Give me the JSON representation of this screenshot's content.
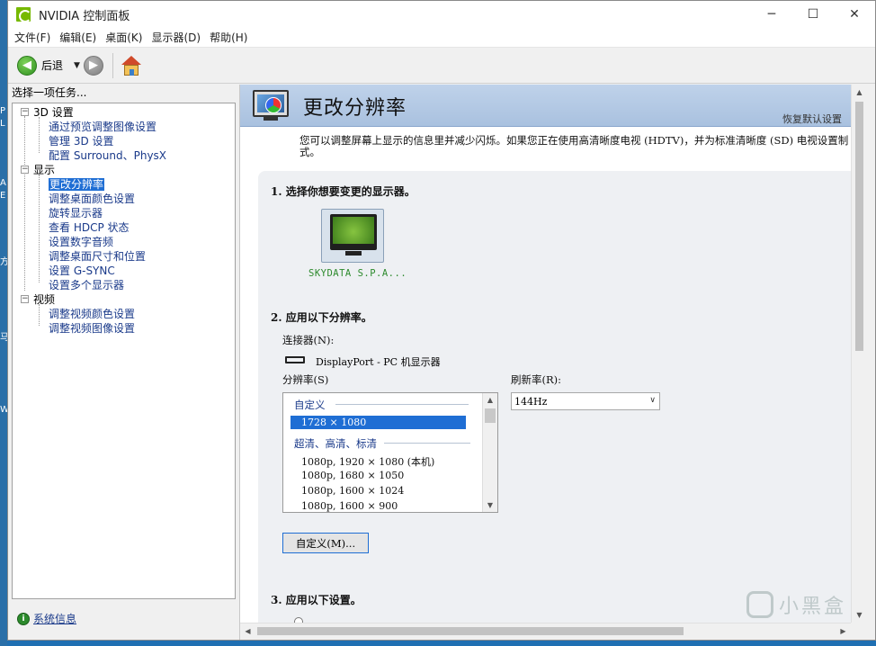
{
  "window": {
    "title": "NVIDIA 控制面板",
    "controls": {
      "minimize": "─",
      "maximize": "☐",
      "close": "✕"
    }
  },
  "menu": [
    "文件(F)",
    "编辑(E)",
    "桌面(K)",
    "显示器(D)",
    "帮助(H)"
  ],
  "toolbar": {
    "back_label": "后退"
  },
  "left_pane": {
    "header": "选择一项任务...",
    "tree": [
      {
        "label": "3D 设置",
        "kind": "category"
      },
      {
        "label": "通过预览调整图像设置",
        "kind": "link"
      },
      {
        "label": "管理 3D 设置",
        "kind": "link"
      },
      {
        "label": "配置 Surround、PhysX",
        "kind": "link"
      },
      {
        "label": "显示",
        "kind": "category"
      },
      {
        "label": "更改分辨率",
        "kind": "selected"
      },
      {
        "label": "调整桌面颜色设置",
        "kind": "link"
      },
      {
        "label": "旋转显示器",
        "kind": "link"
      },
      {
        "label": "查看 HDCP 状态",
        "kind": "link"
      },
      {
        "label": "设置数字音频",
        "kind": "link"
      },
      {
        "label": "调整桌面尺寸和位置",
        "kind": "link"
      },
      {
        "label": "设置 G-SYNC",
        "kind": "link"
      },
      {
        "label": "设置多个显示器",
        "kind": "link"
      },
      {
        "label": "视频",
        "kind": "category"
      },
      {
        "label": "调整视频颜色设置",
        "kind": "link"
      },
      {
        "label": "调整视频图像设置",
        "kind": "link"
      }
    ],
    "system_info": "系统信息"
  },
  "content": {
    "title": "更改分辨率",
    "restore_defaults": "恢复默认设置",
    "description": "您可以调整屏幕上显示的信息里并减少闪烁。如果您正在使用高清晰度电视 (HDTV)，并为标准清晰度 (SD) 电视设置制式。",
    "step1": "1. 选择你想要变更的显示器。",
    "display_name": "SKYDATA S.P.A...",
    "step2": "2. 应用以下分辨率。",
    "connector_label": "连接器(N):",
    "connector_value": "DisplayPort - PC 机显示器",
    "resolution_label": "分辨率(S)",
    "refresh_label": "刷新率(R):",
    "refresh_value": "144Hz",
    "res_group_custom": "自定义",
    "res_selected": "1728 × 1080",
    "res_group_hd": "超清、高清、标清",
    "res_items": [
      "1080p, 1920 × 1080 (本机)",
      "1080p, 1680 × 1050",
      "1080p, 1600 × 1024",
      "1080p, 1600 × 900"
    ],
    "custom_button": "自定义(M)...",
    "step3": "3. 应用以下设置。"
  },
  "desktop_letters": [
    "P",
    "L",
    "A",
    "E",
    "方",
    "马",
    "W"
  ],
  "watermark": "小黑盒",
  "colors": {
    "selection": "#1f6ed4",
    "header_band": "#b5c9e4",
    "nvidia_green": "#76b900"
  }
}
